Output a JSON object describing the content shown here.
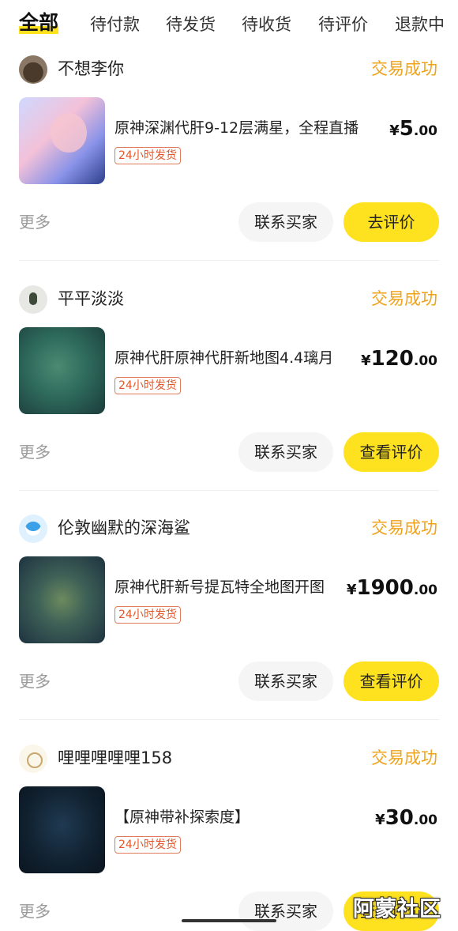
{
  "tabs": [
    "全部",
    "待付款",
    "待发货",
    "待收货",
    "待评价",
    "退款中"
  ],
  "orders": [
    {
      "user": "不想李你",
      "status": "交易成功",
      "title": "原神深渊代肝9-12层满星，全程直播",
      "tag": "24小时发货",
      "price_int": "5",
      "price_dec": ".00",
      "more": "更多",
      "contact": "联系买家",
      "action": "去评价"
    },
    {
      "user": "平平淡淡",
      "status": "交易成功",
      "title": "原神代肝原神代肝新地图4.4璃月",
      "tag": "24小时发货",
      "price_int": "120",
      "price_dec": ".00",
      "more": "更多",
      "contact": "联系买家",
      "action": "查看评价"
    },
    {
      "user": "伦敦幽默的深海鲨",
      "status": "交易成功",
      "title": "原神代肝新号提瓦特全地图开图",
      "tag": "24小时发货",
      "price_int": "1900",
      "price_dec": ".00",
      "more": "更多",
      "contact": "联系买家",
      "action": "查看评价"
    },
    {
      "user": "哩哩哩哩哩158",
      "status": "交易成功",
      "title": "【原神带补探索度】",
      "tag": "24小时发货",
      "price_int": "30",
      "price_dec": ".00",
      "more": "更多",
      "contact": "联系买家",
      "action": "查看评价"
    }
  ],
  "currency": "¥",
  "watermark": "阿蒙社区",
  "colors": {
    "accent": "#ffe21f",
    "status": "#f0a21a",
    "tag": "#e0572b"
  }
}
